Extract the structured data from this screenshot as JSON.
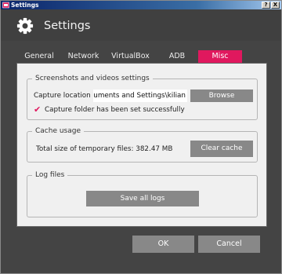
{
  "window": {
    "title": "Settings"
  },
  "titlebar_buttons": {
    "help": "?",
    "close": "X"
  },
  "header": {
    "title": "Settings"
  },
  "tabs": [
    {
      "label": "General"
    },
    {
      "label": "Network"
    },
    {
      "label": "VirtualBox"
    },
    {
      "label": "ADB"
    },
    {
      "label": "Misc"
    }
  ],
  "screenshots_group": {
    "legend": "Screenshots and videos settings",
    "capture_label": "Capture location",
    "capture_value": "uments and Settings\\kilian",
    "browse_label": "Browse",
    "success_text": "Capture folder has been set successfully"
  },
  "cache_group": {
    "legend": "Cache usage",
    "size_text": "Total size of temporary files: 382.47 MB",
    "clear_label": "Clear cache"
  },
  "log_group": {
    "legend": "Log files",
    "save_label": "Save all logs"
  },
  "footer": {
    "ok_label": "OK",
    "cancel_label": "Cancel"
  },
  "colors": {
    "accent": "#e0185e",
    "header_bg": "#404040",
    "button_bg": "#888888"
  }
}
